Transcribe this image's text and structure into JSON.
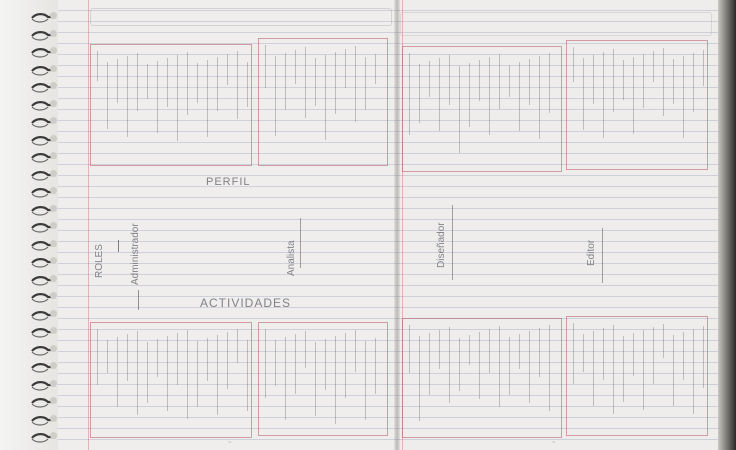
{
  "notebook": {
    "colors": {
      "ink": "#6f6f78",
      "margin_red": "#cd6e78",
      "paper": "#efeeec"
    },
    "labels": {
      "perfil": "PERFIL",
      "actividades": "ACTIVIDADES",
      "roles": "ROLES",
      "analista": "Analista",
      "administrador": "Administrador",
      "disenador": "Diseñador",
      "editor": "Editor"
    }
  }
}
